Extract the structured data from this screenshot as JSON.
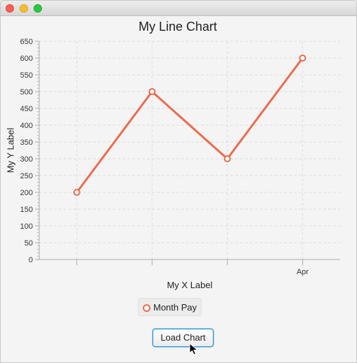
{
  "chart_data": {
    "type": "line",
    "title": "My Line Chart",
    "xlabel": "My X Label",
    "ylabel": "My Y Label",
    "categories": [
      "",
      "",
      "",
      "Apr"
    ],
    "series": [
      {
        "name": "Month Pay",
        "values": [
          200,
          500,
          300,
          600
        ],
        "color": "#ee6b4d"
      }
    ],
    "ylim": [
      0,
      650
    ],
    "ytick_step": 50,
    "yticks": [
      "0",
      "50",
      "100",
      "150",
      "200",
      "250",
      "300",
      "350",
      "400",
      "450",
      "500",
      "550",
      "600",
      "650"
    ],
    "grid": true,
    "legend_position": "bottom"
  },
  "buttons": {
    "load_label": "Load Chart"
  },
  "colors": {
    "series": "#ee6b4d",
    "grid": "#dddddd",
    "axis": "#aaaaaa",
    "button_focus": "#3a9ad8"
  }
}
